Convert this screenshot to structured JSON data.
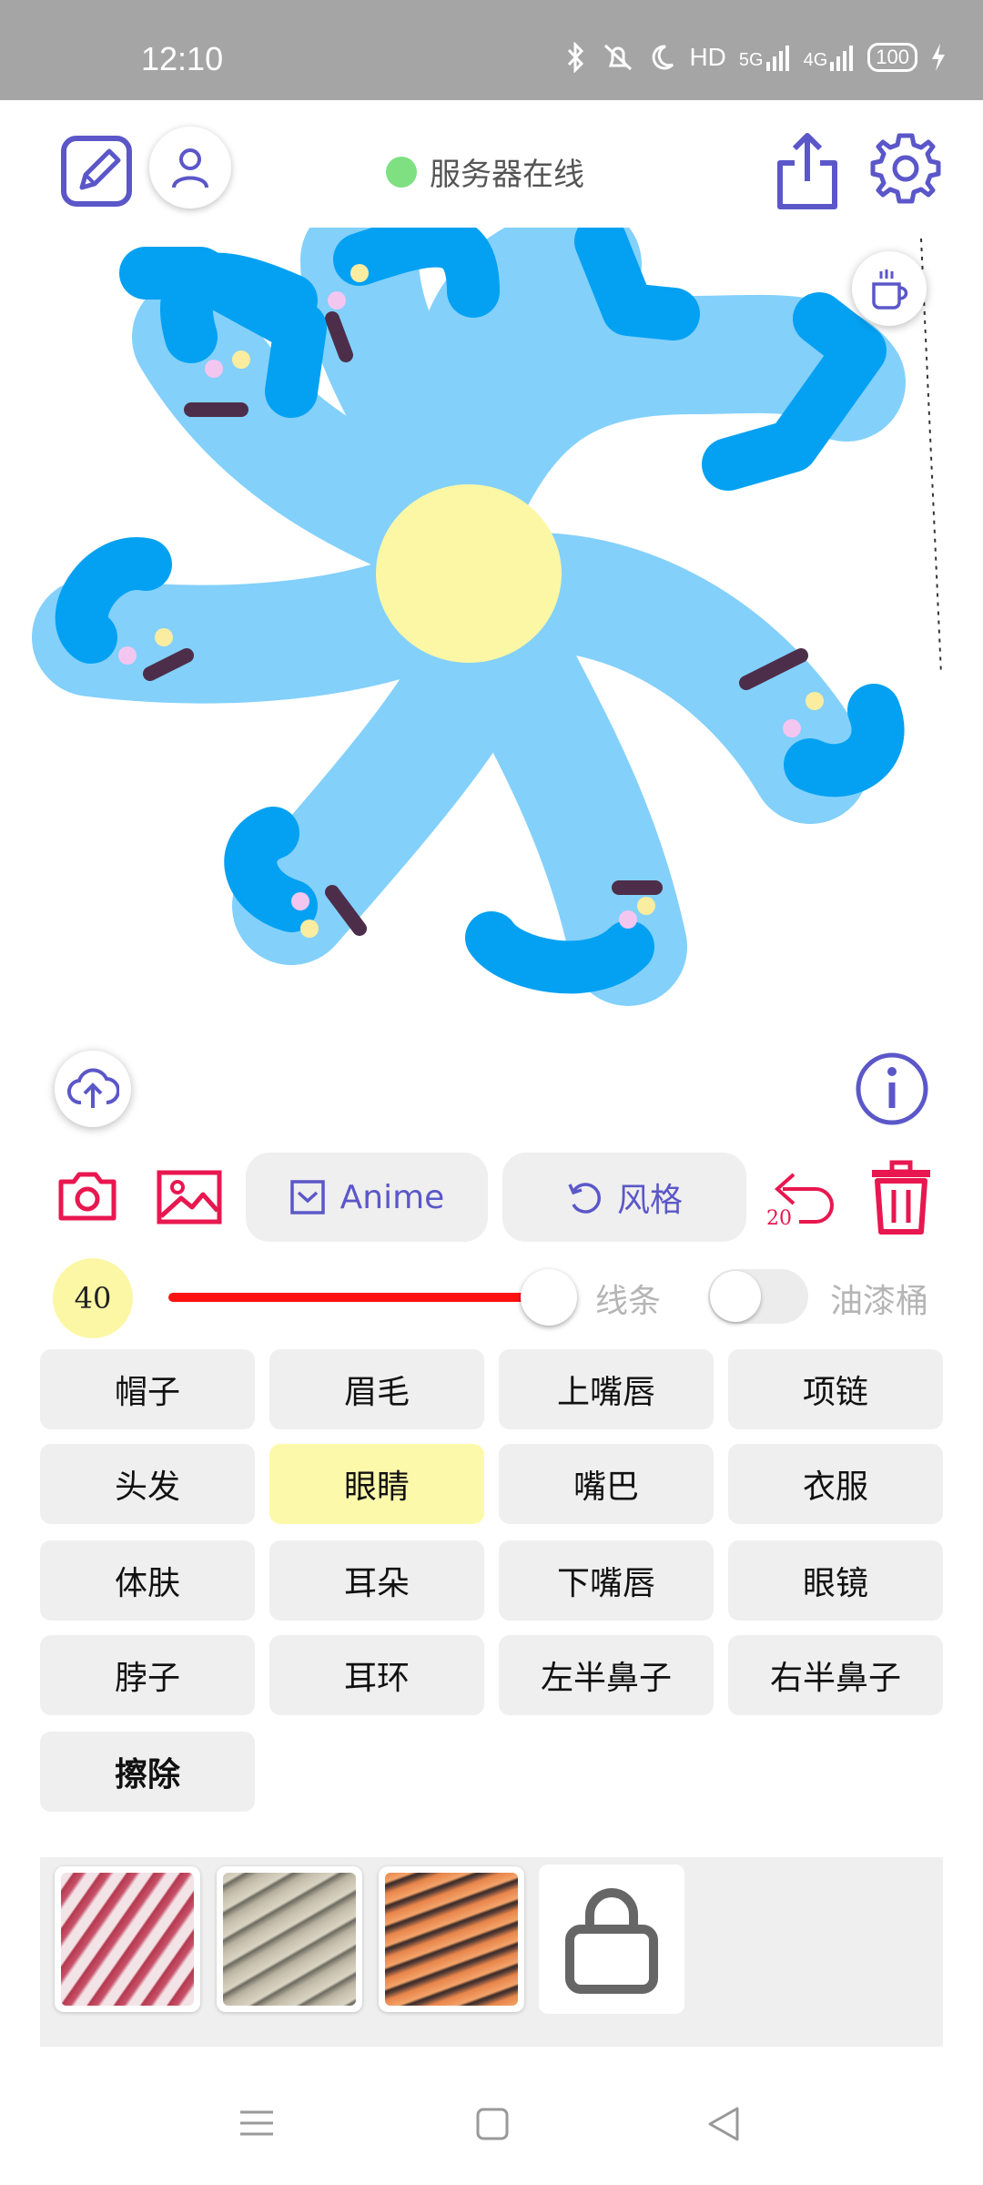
{
  "status_bar": {
    "time": "12:10",
    "icons": [
      "bluetooth-icon",
      "mute-icon",
      "moon-icon"
    ],
    "hd": "HD",
    "net1": "5G",
    "net2": "4G",
    "battery": "100"
  },
  "header": {
    "server_status": "服务器在线",
    "online_color": "#7ee081",
    "accent": "#5b57c9"
  },
  "toolbar": {
    "anime_label": "Anime",
    "style_label": "风格",
    "undo_count": "20"
  },
  "brush": {
    "size": "40",
    "mode_label": "线条",
    "fill_label": "油漆桶",
    "level_fraction": 0.82,
    "fill_enabled": false
  },
  "parts": [
    {
      "label": "帽子"
    },
    {
      "label": "眉毛"
    },
    {
      "label": "上嘴唇"
    },
    {
      "label": "项链"
    },
    {
      "label": "头发"
    },
    {
      "label": "眼睛",
      "selected": true
    },
    {
      "label": "嘴巴"
    },
    {
      "label": "衣服"
    },
    {
      "label": "体肤"
    },
    {
      "label": "耳朵"
    },
    {
      "label": "下嘴唇"
    },
    {
      "label": "眼镜"
    },
    {
      "label": "脖子"
    },
    {
      "label": "耳环"
    },
    {
      "label": "左半鼻子"
    },
    {
      "label": "右半鼻子"
    },
    {
      "label": "擦除"
    }
  ],
  "styles": [
    "style-thumb-crimson",
    "style-thumb-stone",
    "style-thumb-tiger",
    "locked-style"
  ],
  "colors": {
    "brand_red": "#e8174f",
    "accent_purple": "#5b57c9",
    "slider_red": "#ff1111",
    "selected_part": "#fcf9aa",
    "limb_light": "#83d0fb",
    "limb_dark": "#04a1f2",
    "center_yellow": "#fcf7a5"
  }
}
